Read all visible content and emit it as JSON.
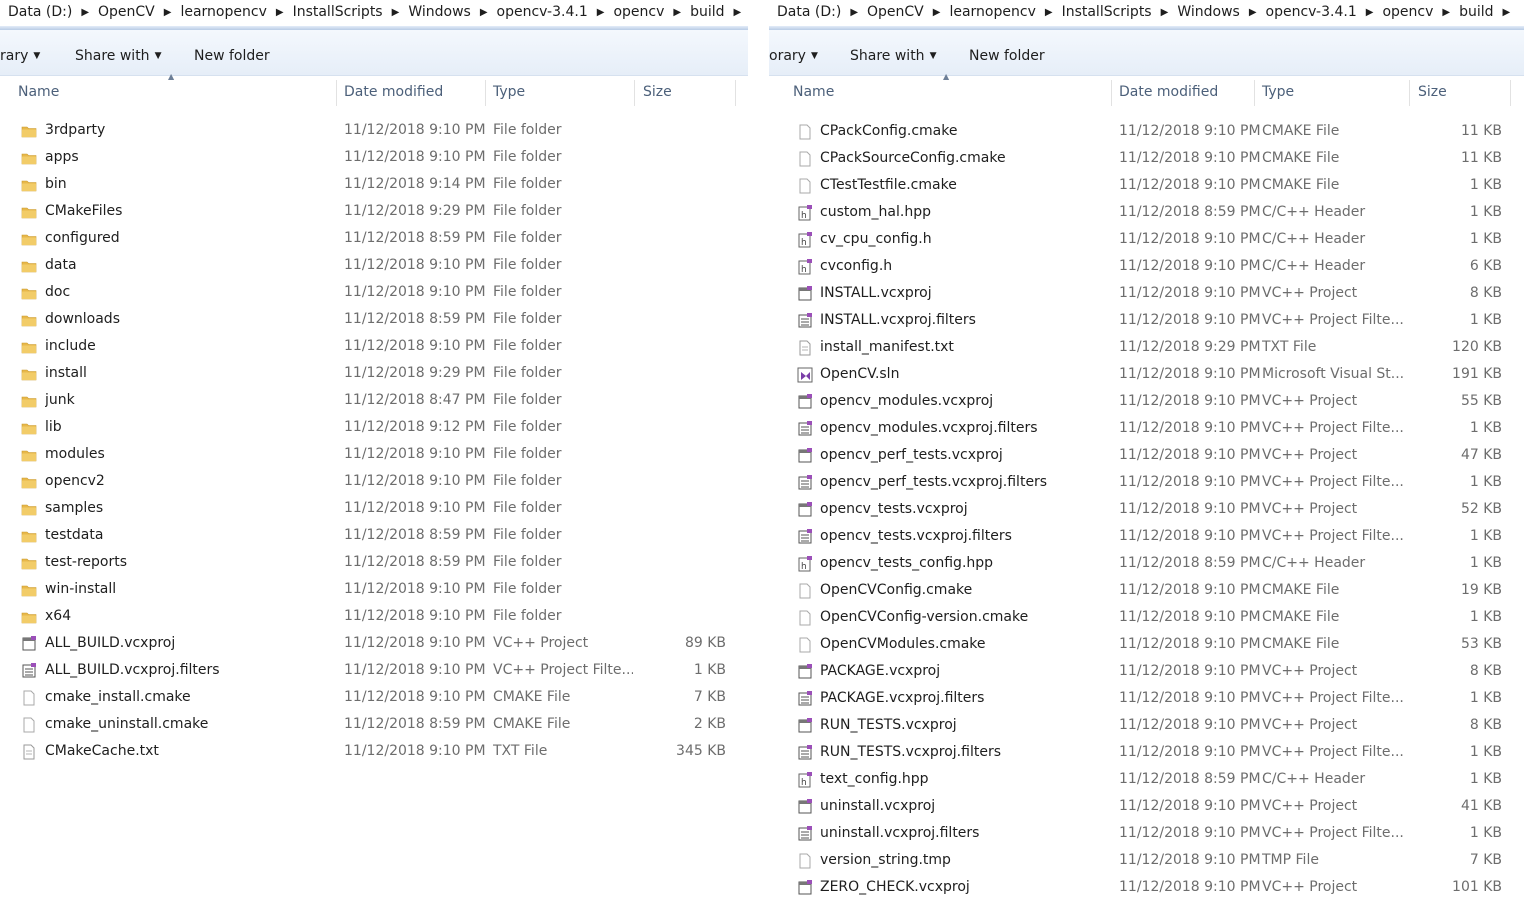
{
  "breadcrumb": [
    "Data (D:)",
    "OpenCV",
    "learnopencv",
    "InstallScripts",
    "Windows",
    "opencv-3.4.1",
    "opencv",
    "build"
  ],
  "toolbar": {
    "library_label": "rary",
    "library_label_right": "orary",
    "share_label": "Share with",
    "new_folder_label": "New folder"
  },
  "columns": {
    "name": "Name",
    "date": "Date modified",
    "type": "Type",
    "size": "Size"
  },
  "left": {
    "rows": [
      {
        "name": "3rdparty",
        "date": "11/12/2018 9:10 PM",
        "type": "File folder",
        "size": "",
        "icon": "folder-icon"
      },
      {
        "name": "apps",
        "date": "11/12/2018 9:10 PM",
        "type": "File folder",
        "size": "",
        "icon": "folder-icon"
      },
      {
        "name": "bin",
        "date": "11/12/2018 9:14 PM",
        "type": "File folder",
        "size": "",
        "icon": "folder-icon"
      },
      {
        "name": "CMakeFiles",
        "date": "11/12/2018 9:29 PM",
        "type": "File folder",
        "size": "",
        "icon": "folder-icon"
      },
      {
        "name": "configured",
        "date": "11/12/2018 8:59 PM",
        "type": "File folder",
        "size": "",
        "icon": "folder-icon"
      },
      {
        "name": "data",
        "date": "11/12/2018 9:10 PM",
        "type": "File folder",
        "size": "",
        "icon": "folder-icon"
      },
      {
        "name": "doc",
        "date": "11/12/2018 9:10 PM",
        "type": "File folder",
        "size": "",
        "icon": "folder-icon"
      },
      {
        "name": "downloads",
        "date": "11/12/2018 8:59 PM",
        "type": "File folder",
        "size": "",
        "icon": "folder-icon"
      },
      {
        "name": "include",
        "date": "11/12/2018 9:10 PM",
        "type": "File folder",
        "size": "",
        "icon": "folder-icon"
      },
      {
        "name": "install",
        "date": "11/12/2018 9:29 PM",
        "type": "File folder",
        "size": "",
        "icon": "folder-icon"
      },
      {
        "name": "junk",
        "date": "11/12/2018 8:47 PM",
        "type": "File folder",
        "size": "",
        "icon": "folder-icon"
      },
      {
        "name": "lib",
        "date": "11/12/2018 9:12 PM",
        "type": "File folder",
        "size": "",
        "icon": "folder-icon"
      },
      {
        "name": "modules",
        "date": "11/12/2018 9:10 PM",
        "type": "File folder",
        "size": "",
        "icon": "folder-icon"
      },
      {
        "name": "opencv2",
        "date": "11/12/2018 9:10 PM",
        "type": "File folder",
        "size": "",
        "icon": "folder-icon"
      },
      {
        "name": "samples",
        "date": "11/12/2018 9:10 PM",
        "type": "File folder",
        "size": "",
        "icon": "folder-icon"
      },
      {
        "name": "testdata",
        "date": "11/12/2018 8:59 PM",
        "type": "File folder",
        "size": "",
        "icon": "folder-icon"
      },
      {
        "name": "test-reports",
        "date": "11/12/2018 8:59 PM",
        "type": "File folder",
        "size": "",
        "icon": "folder-icon"
      },
      {
        "name": "win-install",
        "date": "11/12/2018 9:10 PM",
        "type": "File folder",
        "size": "",
        "icon": "folder-icon"
      },
      {
        "name": "x64",
        "date": "11/12/2018 9:10 PM",
        "type": "File folder",
        "size": "",
        "icon": "folder-icon"
      },
      {
        "name": "ALL_BUILD.vcxproj",
        "date": "11/12/2018 9:10 PM",
        "type": "VC++ Project",
        "size": "89 KB",
        "icon": "vcxproj-icon"
      },
      {
        "name": "ALL_BUILD.vcxproj.filters",
        "date": "11/12/2018 9:10 PM",
        "type": "VC++ Project Filte...",
        "size": "1 KB",
        "icon": "filters-icon"
      },
      {
        "name": "cmake_install.cmake",
        "date": "11/12/2018 9:10 PM",
        "type": "CMAKE File",
        "size": "7 KB",
        "icon": "file-icon"
      },
      {
        "name": "cmake_uninstall.cmake",
        "date": "11/12/2018 8:59 PM",
        "type": "CMAKE File",
        "size": "2 KB",
        "icon": "file-icon"
      },
      {
        "name": "CMakeCache.txt",
        "date": "11/12/2018 9:10 PM",
        "type": "TXT File",
        "size": "345 KB",
        "icon": "txt-icon"
      }
    ]
  },
  "right": {
    "rows": [
      {
        "name": "CPackConfig.cmake",
        "date": "11/12/2018 9:10 PM",
        "type": "CMAKE File",
        "size": "11 KB",
        "icon": "file-icon"
      },
      {
        "name": "CPackSourceConfig.cmake",
        "date": "11/12/2018 9:10 PM",
        "type": "CMAKE File",
        "size": "11 KB",
        "icon": "file-icon"
      },
      {
        "name": "CTestTestfile.cmake",
        "date": "11/12/2018 9:10 PM",
        "type": "CMAKE File",
        "size": "1 KB",
        "icon": "file-icon"
      },
      {
        "name": "custom_hal.hpp",
        "date": "11/12/2018 8:59 PM",
        "type": "C/C++ Header",
        "size": "1 KB",
        "icon": "header-icon"
      },
      {
        "name": "cv_cpu_config.h",
        "date": "11/12/2018 9:10 PM",
        "type": "C/C++ Header",
        "size": "1 KB",
        "icon": "header-icon"
      },
      {
        "name": "cvconfig.h",
        "date": "11/12/2018 9:10 PM",
        "type": "C/C++ Header",
        "size": "6 KB",
        "icon": "header-icon"
      },
      {
        "name": "INSTALL.vcxproj",
        "date": "11/12/2018 9:10 PM",
        "type": "VC++ Project",
        "size": "8 KB",
        "icon": "vcxproj-icon"
      },
      {
        "name": "INSTALL.vcxproj.filters",
        "date": "11/12/2018 9:10 PM",
        "type": "VC++ Project Filte...",
        "size": "1 KB",
        "icon": "filters-icon"
      },
      {
        "name": "install_manifest.txt",
        "date": "11/12/2018 9:29 PM",
        "type": "TXT File",
        "size": "120 KB",
        "icon": "txt-icon"
      },
      {
        "name": "OpenCV.sln",
        "date": "11/12/2018 9:10 PM",
        "type": "Microsoft Visual St...",
        "size": "191 KB",
        "icon": "sln-icon"
      },
      {
        "name": "opencv_modules.vcxproj",
        "date": "11/12/2018 9:10 PM",
        "type": "VC++ Project",
        "size": "55 KB",
        "icon": "vcxproj-icon"
      },
      {
        "name": "opencv_modules.vcxproj.filters",
        "date": "11/12/2018 9:10 PM",
        "type": "VC++ Project Filte...",
        "size": "1 KB",
        "icon": "filters-icon"
      },
      {
        "name": "opencv_perf_tests.vcxproj",
        "date": "11/12/2018 9:10 PM",
        "type": "VC++ Project",
        "size": "47 KB",
        "icon": "vcxproj-icon"
      },
      {
        "name": "opencv_perf_tests.vcxproj.filters",
        "date": "11/12/2018 9:10 PM",
        "type": "VC++ Project Filte...",
        "size": "1 KB",
        "icon": "filters-icon"
      },
      {
        "name": "opencv_tests.vcxproj",
        "date": "11/12/2018 9:10 PM",
        "type": "VC++ Project",
        "size": "52 KB",
        "icon": "vcxproj-icon"
      },
      {
        "name": "opencv_tests.vcxproj.filters",
        "date": "11/12/2018 9:10 PM",
        "type": "VC++ Project Filte...",
        "size": "1 KB",
        "icon": "filters-icon"
      },
      {
        "name": "opencv_tests_config.hpp",
        "date": "11/12/2018 8:59 PM",
        "type": "C/C++ Header",
        "size": "1 KB",
        "icon": "header-icon"
      },
      {
        "name": "OpenCVConfig.cmake",
        "date": "11/12/2018 9:10 PM",
        "type": "CMAKE File",
        "size": "19 KB",
        "icon": "file-icon"
      },
      {
        "name": "OpenCVConfig-version.cmake",
        "date": "11/12/2018 9:10 PM",
        "type": "CMAKE File",
        "size": "1 KB",
        "icon": "file-icon"
      },
      {
        "name": "OpenCVModules.cmake",
        "date": "11/12/2018 9:10 PM",
        "type": "CMAKE File",
        "size": "53 KB",
        "icon": "file-icon"
      },
      {
        "name": "PACKAGE.vcxproj",
        "date": "11/12/2018 9:10 PM",
        "type": "VC++ Project",
        "size": "8 KB",
        "icon": "vcxproj-icon"
      },
      {
        "name": "PACKAGE.vcxproj.filters",
        "date": "11/12/2018 9:10 PM",
        "type": "VC++ Project Filte...",
        "size": "1 KB",
        "icon": "filters-icon"
      },
      {
        "name": "RUN_TESTS.vcxproj",
        "date": "11/12/2018 9:10 PM",
        "type": "VC++ Project",
        "size": "8 KB",
        "icon": "vcxproj-icon"
      },
      {
        "name": "RUN_TESTS.vcxproj.filters",
        "date": "11/12/2018 9:10 PM",
        "type": "VC++ Project Filte...",
        "size": "1 KB",
        "icon": "filters-icon"
      },
      {
        "name": "text_config.hpp",
        "date": "11/12/2018 8:59 PM",
        "type": "C/C++ Header",
        "size": "1 KB",
        "icon": "header-icon"
      },
      {
        "name": "uninstall.vcxproj",
        "date": "11/12/2018 9:10 PM",
        "type": "VC++ Project",
        "size": "41 KB",
        "icon": "vcxproj-icon"
      },
      {
        "name": "uninstall.vcxproj.filters",
        "date": "11/12/2018 9:10 PM",
        "type": "VC++ Project Filte...",
        "size": "1 KB",
        "icon": "filters-icon"
      },
      {
        "name": "version_string.tmp",
        "date": "11/12/2018 9:10 PM",
        "type": "TMP File",
        "size": "7 KB",
        "icon": "file-icon"
      },
      {
        "name": "ZERO_CHECK.vcxproj",
        "date": "11/12/2018 9:10 PM",
        "type": "VC++ Project",
        "size": "101 KB",
        "icon": "vcxproj-icon"
      }
    ]
  },
  "colors": {
    "folder": "#e8b84a",
    "header_text": "#4c607a",
    "secondary_text": "#6d6d6d",
    "toolbar_bg": "#e9f0f9"
  }
}
